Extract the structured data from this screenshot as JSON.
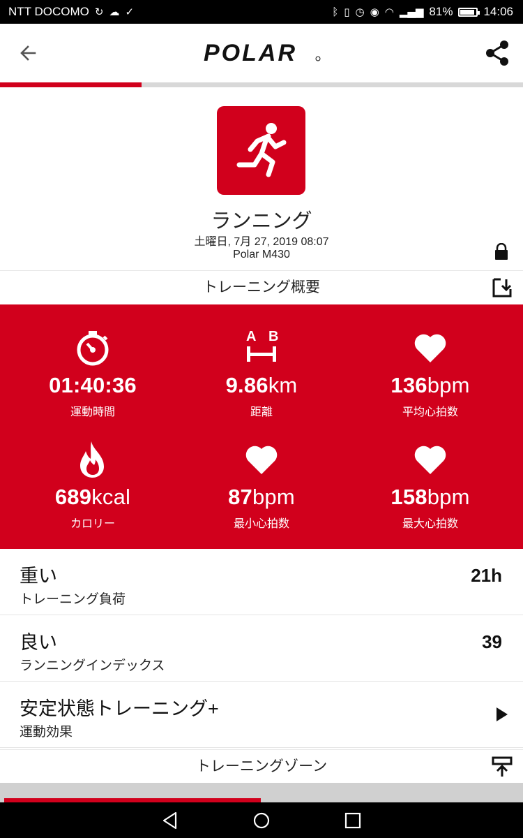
{
  "status": {
    "carrier": "NTT DOCOMO",
    "battery": "81%",
    "time": "14:06"
  },
  "header": {
    "logo": "POLAR",
    "progress_fraction": 0.27
  },
  "sport": {
    "name": "ランニング",
    "date": "土曜日, 7月 27, 2019 08:07",
    "device": "Polar M430"
  },
  "summary_section": {
    "title": "トレーニング概要"
  },
  "stats": [
    {
      "icon": "stopwatch-icon",
      "value": "01:40:36",
      "unit": "",
      "label": "運動時間"
    },
    {
      "icon": "distance-icon",
      "value": "9.86",
      "unit": "km",
      "label": "距離"
    },
    {
      "icon": "heart-icon",
      "value": "136",
      "unit": "bpm",
      "label": "平均心拍数"
    },
    {
      "icon": "flame-icon",
      "value": "689",
      "unit": "kcal",
      "label": "カロリー"
    },
    {
      "icon": "heart-icon",
      "value": "87",
      "unit": "bpm",
      "label": "最小心拍数"
    },
    {
      "icon": "heart-icon",
      "value": "158",
      "unit": "bpm",
      "label": "最大心拍数"
    }
  ],
  "distance_icon_labels": {
    "a": "A",
    "b": "B"
  },
  "rows": [
    {
      "title": "重い",
      "sub": "トレーニング負荷",
      "value": "21h"
    },
    {
      "title": "良い",
      "sub": "ランニングインデックス",
      "value": "39"
    },
    {
      "title": "安定状態トレーニング+",
      "sub": "運動効果",
      "value": ""
    }
  ],
  "zones_section": {
    "title": "トレーニングゾーン",
    "zone_bar_fraction": 0.49
  },
  "colors": {
    "brand_red": "#d1001c"
  }
}
